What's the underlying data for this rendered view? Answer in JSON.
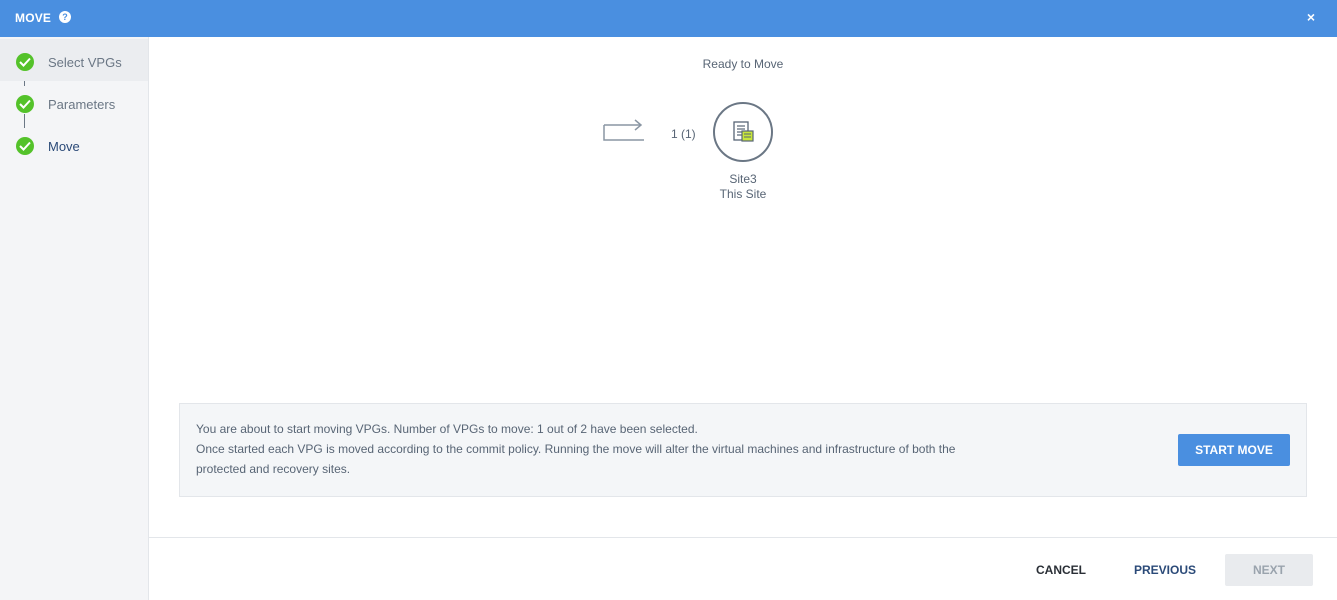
{
  "window": {
    "title": "MOVE",
    "help_glyph": "?",
    "close_glyph": "×"
  },
  "sidebar": {
    "steps": [
      {
        "label": "Select VPGs",
        "status": "complete"
      },
      {
        "label": "Parameters",
        "status": "complete"
      },
      {
        "label": "Move",
        "status": "current"
      }
    ]
  },
  "main": {
    "status": "Ready to Move",
    "vpg_count": "1 (1)",
    "site": {
      "name": "Site3",
      "descriptor": "This Site"
    },
    "info": {
      "line1": "You are about to start moving VPGs. Number of VPGs to move: 1 out of 2 have been selected.",
      "line2": "Once started each VPG is moved according to the commit policy. Running the move will alter the virtual machines and infrastructure of both the",
      "line3": "protected and recovery sites."
    },
    "start_button": "START MOVE"
  },
  "footer": {
    "cancel": "CANCEL",
    "previous": "PREVIOUS",
    "next": "NEXT"
  },
  "colors": {
    "accent": "#4a8fe0",
    "success": "#54c22a",
    "disabled_bg": "#e9ebee"
  },
  "icons": [
    "help-icon",
    "close-icon",
    "check-icon",
    "move-arrow-icon",
    "site-icon"
  ]
}
